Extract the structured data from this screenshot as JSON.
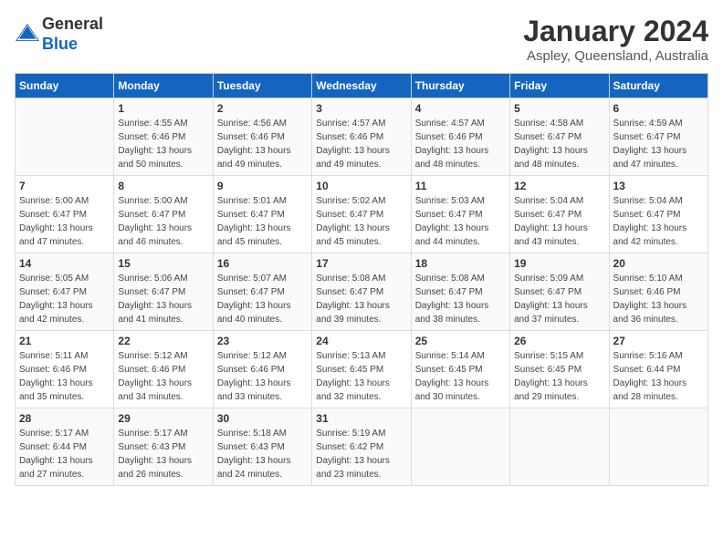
{
  "logo": {
    "general": "General",
    "blue": "Blue"
  },
  "title": "January 2024",
  "subtitle": "Aspley, Queensland, Australia",
  "weekdays": [
    "Sunday",
    "Monday",
    "Tuesday",
    "Wednesday",
    "Thursday",
    "Friday",
    "Saturday"
  ],
  "weeks": [
    [
      {
        "day": "",
        "info": ""
      },
      {
        "day": "1",
        "info": "Sunrise: 4:55 AM\nSunset: 6:46 PM\nDaylight: 13 hours\nand 50 minutes."
      },
      {
        "day": "2",
        "info": "Sunrise: 4:56 AM\nSunset: 6:46 PM\nDaylight: 13 hours\nand 49 minutes."
      },
      {
        "day": "3",
        "info": "Sunrise: 4:57 AM\nSunset: 6:46 PM\nDaylight: 13 hours\nand 49 minutes."
      },
      {
        "day": "4",
        "info": "Sunrise: 4:57 AM\nSunset: 6:46 PM\nDaylight: 13 hours\nand 48 minutes."
      },
      {
        "day": "5",
        "info": "Sunrise: 4:58 AM\nSunset: 6:47 PM\nDaylight: 13 hours\nand 48 minutes."
      },
      {
        "day": "6",
        "info": "Sunrise: 4:59 AM\nSunset: 6:47 PM\nDaylight: 13 hours\nand 47 minutes."
      }
    ],
    [
      {
        "day": "7",
        "info": "Sunrise: 5:00 AM\nSunset: 6:47 PM\nDaylight: 13 hours\nand 47 minutes."
      },
      {
        "day": "8",
        "info": "Sunrise: 5:00 AM\nSunset: 6:47 PM\nDaylight: 13 hours\nand 46 minutes."
      },
      {
        "day": "9",
        "info": "Sunrise: 5:01 AM\nSunset: 6:47 PM\nDaylight: 13 hours\nand 45 minutes."
      },
      {
        "day": "10",
        "info": "Sunrise: 5:02 AM\nSunset: 6:47 PM\nDaylight: 13 hours\nand 45 minutes."
      },
      {
        "day": "11",
        "info": "Sunrise: 5:03 AM\nSunset: 6:47 PM\nDaylight: 13 hours\nand 44 minutes."
      },
      {
        "day": "12",
        "info": "Sunrise: 5:04 AM\nSunset: 6:47 PM\nDaylight: 13 hours\nand 43 minutes."
      },
      {
        "day": "13",
        "info": "Sunrise: 5:04 AM\nSunset: 6:47 PM\nDaylight: 13 hours\nand 42 minutes."
      }
    ],
    [
      {
        "day": "14",
        "info": "Sunrise: 5:05 AM\nSunset: 6:47 PM\nDaylight: 13 hours\nand 42 minutes."
      },
      {
        "day": "15",
        "info": "Sunrise: 5:06 AM\nSunset: 6:47 PM\nDaylight: 13 hours\nand 41 minutes."
      },
      {
        "day": "16",
        "info": "Sunrise: 5:07 AM\nSunset: 6:47 PM\nDaylight: 13 hours\nand 40 minutes."
      },
      {
        "day": "17",
        "info": "Sunrise: 5:08 AM\nSunset: 6:47 PM\nDaylight: 13 hours\nand 39 minutes."
      },
      {
        "day": "18",
        "info": "Sunrise: 5:08 AM\nSunset: 6:47 PM\nDaylight: 13 hours\nand 38 minutes."
      },
      {
        "day": "19",
        "info": "Sunrise: 5:09 AM\nSunset: 6:47 PM\nDaylight: 13 hours\nand 37 minutes."
      },
      {
        "day": "20",
        "info": "Sunrise: 5:10 AM\nSunset: 6:46 PM\nDaylight: 13 hours\nand 36 minutes."
      }
    ],
    [
      {
        "day": "21",
        "info": "Sunrise: 5:11 AM\nSunset: 6:46 PM\nDaylight: 13 hours\nand 35 minutes."
      },
      {
        "day": "22",
        "info": "Sunrise: 5:12 AM\nSunset: 6:46 PM\nDaylight: 13 hours\nand 34 minutes."
      },
      {
        "day": "23",
        "info": "Sunrise: 5:12 AM\nSunset: 6:46 PM\nDaylight: 13 hours\nand 33 minutes."
      },
      {
        "day": "24",
        "info": "Sunrise: 5:13 AM\nSunset: 6:45 PM\nDaylight: 13 hours\nand 32 minutes."
      },
      {
        "day": "25",
        "info": "Sunrise: 5:14 AM\nSunset: 6:45 PM\nDaylight: 13 hours\nand 30 minutes."
      },
      {
        "day": "26",
        "info": "Sunrise: 5:15 AM\nSunset: 6:45 PM\nDaylight: 13 hours\nand 29 minutes."
      },
      {
        "day": "27",
        "info": "Sunrise: 5:16 AM\nSunset: 6:44 PM\nDaylight: 13 hours\nand 28 minutes."
      }
    ],
    [
      {
        "day": "28",
        "info": "Sunrise: 5:17 AM\nSunset: 6:44 PM\nDaylight: 13 hours\nand 27 minutes."
      },
      {
        "day": "29",
        "info": "Sunrise: 5:17 AM\nSunset: 6:43 PM\nDaylight: 13 hours\nand 26 minutes."
      },
      {
        "day": "30",
        "info": "Sunrise: 5:18 AM\nSunset: 6:43 PM\nDaylight: 13 hours\nand 24 minutes."
      },
      {
        "day": "31",
        "info": "Sunrise: 5:19 AM\nSunset: 6:42 PM\nDaylight: 13 hours\nand 23 minutes."
      },
      {
        "day": "",
        "info": ""
      },
      {
        "day": "",
        "info": ""
      },
      {
        "day": "",
        "info": ""
      }
    ]
  ]
}
